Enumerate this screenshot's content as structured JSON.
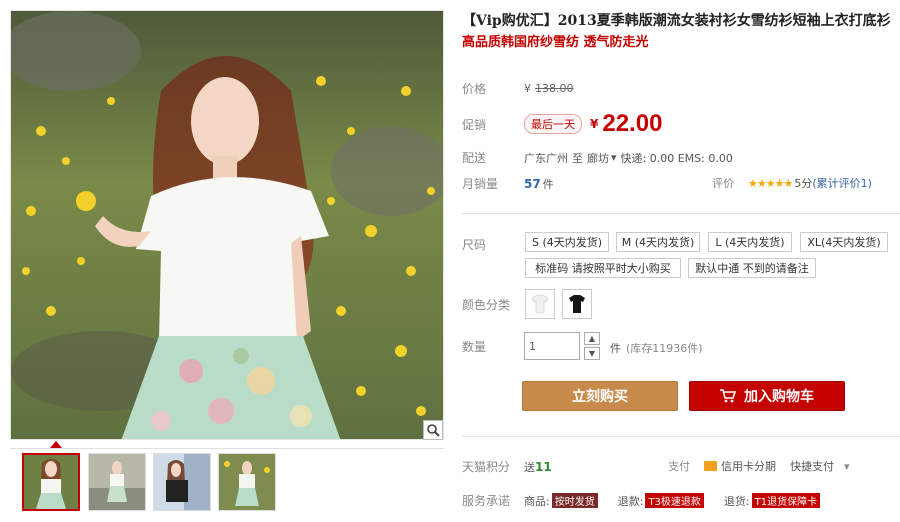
{
  "product": {
    "title": "【Vip购优汇】2013夏季韩版潮流女装衬衫女雪纺衫短袖上衣打底衫",
    "subtitle": "高品质韩国府纱雪纺 透气防走光"
  },
  "pricing": {
    "original_label": "价格",
    "original_currency": "¥",
    "original_price": "138.00",
    "promo_label": "促销",
    "promo_badge": "最后一天",
    "promo_currency": "¥",
    "promo_price": "22.00"
  },
  "shipping": {
    "label": "配送",
    "from": "广东广州",
    "to_word": "至",
    "dest": "廊坊",
    "fees": "快递: 0.00 EMS: 0.00"
  },
  "sales": {
    "label": "月销量",
    "count": "57",
    "unit": "件",
    "review_label": "评价",
    "stars": "★★★★★",
    "rating": "5分",
    "review_link": "(累计评价1)"
  },
  "size": {
    "label": "尺码",
    "options": [
      "S (4天内发货)",
      "M (4天内发货)",
      "L (4天内发货)",
      "XL(4天内发货)",
      "标准码 请按照平时大小购买",
      "默认中通 不到的请备注"
    ]
  },
  "color": {
    "label": "颜色分类"
  },
  "quantity": {
    "label": "数量",
    "value": "1",
    "unit": "件",
    "stock": "(库存11936件)"
  },
  "actions": {
    "buy": "立刻购买",
    "cart": "加入购物车"
  },
  "footer": {
    "points_label": "天猫积分",
    "points_send": "送",
    "points_value": "11",
    "pay_label": "支付",
    "credit": "信用卡分期",
    "fast_pay": "快捷支付",
    "service_label": "服务承诺",
    "goods": "商品:",
    "goods_badge": "按时发货",
    "refund": "退款:",
    "refund_badge": "T3极速退款",
    "return": "退货:",
    "return_badge": "T1退货保障卡"
  },
  "colors": {
    "accent": "#c40000",
    "buy_button": "#c88a4a",
    "link": "#3366aa"
  }
}
